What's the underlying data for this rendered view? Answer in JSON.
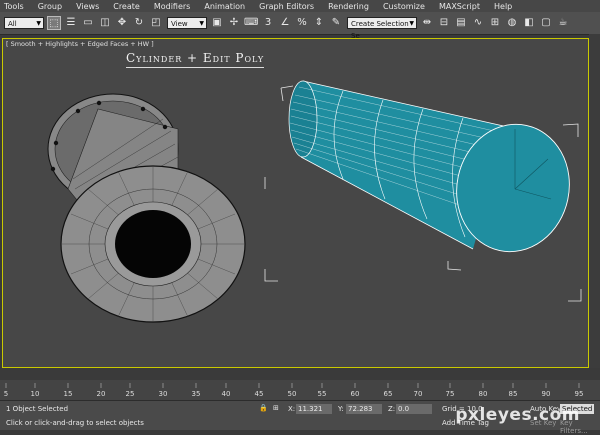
{
  "menu": {
    "items": [
      "Tools",
      "Group",
      "Views",
      "Create",
      "Modifiers",
      "Animation",
      "Graph Editors",
      "Rendering",
      "Customize",
      "MAXScript",
      "Help"
    ]
  },
  "toolbar": {
    "selection_filter": "All",
    "reference_coord": "View",
    "named_selection": "Create Selection Se",
    "icons": [
      "undo-icon",
      "select-object-icon",
      "select-by-name-icon",
      "rect-selection-icon",
      "window-crossing-icon",
      "move-icon",
      "rotate-icon",
      "scale-icon",
      "reference-coord-icon",
      "pivot-icon",
      "select-manipulate-icon",
      "keyboard-shortcut-icon",
      "snap-3d-icon",
      "angle-snap-icon",
      "percent-snap-icon",
      "spinner-snap-icon",
      "edit-named-sel-icon",
      "mirror-icon",
      "align-icon",
      "layer-icon",
      "curve-editor-icon",
      "schematic-icon",
      "material-editor-icon",
      "render-setup-icon",
      "render-frame-icon",
      "render-icon"
    ],
    "snap_label": "3",
    "percent_label": "%"
  },
  "viewport": {
    "label": "[ Smooth + Highlights + Edged Faces + HW ]",
    "title": "Cylinder + Edit Poly"
  },
  "timeline": {
    "ticks": [
      "5",
      "10",
      "15",
      "20",
      "25",
      "30",
      "35",
      "40",
      "45",
      "50",
      "55",
      "60",
      "65",
      "70",
      "75",
      "80",
      "85",
      "90",
      "95"
    ]
  },
  "status": {
    "selected": "1 Object Selected",
    "prompt": "Click or click-and-drag to select objects",
    "x_label": "X:",
    "x_value": "11.321",
    "y_label": "Y:",
    "y_value": "72.283",
    "z_label": "Z:",
    "z_value": "0.0",
    "grid": "Grid = 10.0",
    "auto_key": "Auto Key",
    "selected_mode": "Selected",
    "add_time_tag": "Add Time Tag",
    "set_key": "Set Key",
    "key_filters": "Key Filters..."
  },
  "colors": {
    "cylinder": "#1f8ea0",
    "viewport_bg": "#474747",
    "active_border": "#c9c900"
  },
  "watermark": "pxleyes.com"
}
